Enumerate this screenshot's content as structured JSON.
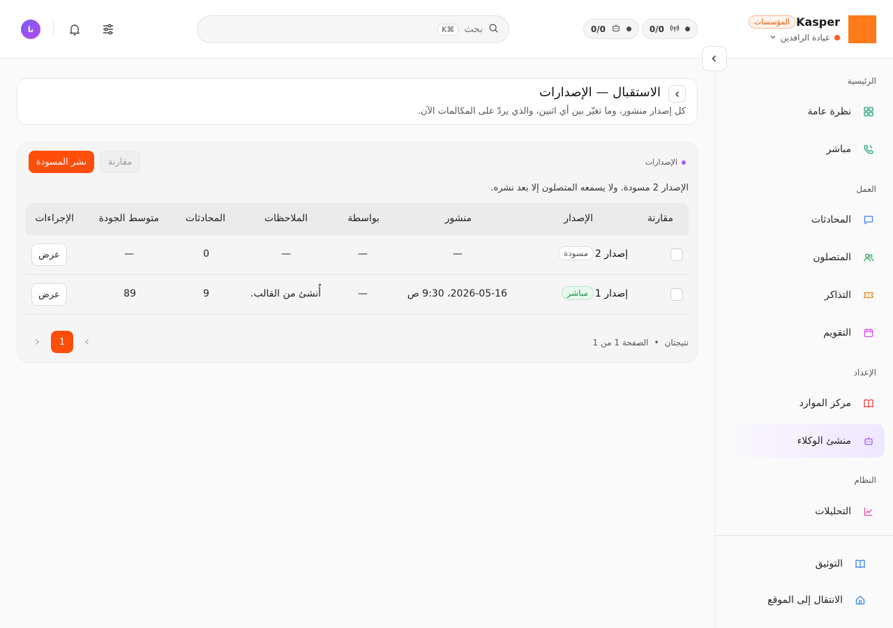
{
  "header": {
    "brand": "Kasper",
    "org_badge": "المؤسسات",
    "clinic": "عيادة الرافدين",
    "counter_calls": "0/0",
    "counter_agents": "0/0",
    "search_placeholder": "بحث",
    "search_shortcut": "⌘K",
    "avatar_initials": "نا"
  },
  "sidebar": {
    "sections": {
      "home": "الرئيسية",
      "work": "العمل",
      "setup": "الإعداد",
      "system": "النظام"
    },
    "items": {
      "overview": "نظرة عامة",
      "live": "مباشر",
      "conversations": "المحادثات",
      "callers": "المتصلون",
      "tickets": "التذاكر",
      "calendar": "التقويم",
      "resources": "مركز الموارد",
      "agent_builder": "منشئ الوكلاء",
      "analytics": "التحليلات",
      "docs": "التوثيق",
      "go_to_site": "الانتقال إلى الموقع"
    },
    "icon_colors": {
      "overview": "#1aa37a",
      "live": "#1aa37a",
      "conversations": "#3b82f6",
      "callers": "#22a35a",
      "tickets": "#f08a24",
      "calendar": "#d946ef",
      "resources": "#ef4444",
      "agent_builder": "#a855f7",
      "analytics": "#ec4899",
      "docs": "#3b82f6",
      "go_to_site": "#3b82f6"
    }
  },
  "page": {
    "title": "الاستقبال — الإصدارات",
    "subtitle": "كل إصدار منشور، وما تغيّر بين أي اثنين، والذي يردّ على المكالمات الآن."
  },
  "panel": {
    "tag": "الإصدارات",
    "publish_label": "نشر المسودة",
    "compare_label": "مقارنة",
    "note": "الإصدار 2 مسودة. ولا يسمعه المتصلون إلا بعد نشره."
  },
  "table": {
    "columns": {
      "compare": "مقارنة",
      "version": "الإصدار",
      "published": "منشور",
      "by": "بواسطة",
      "notes": "الملاحظات",
      "conversations": "المحادثات",
      "avg_quality": "متوسط الجودة",
      "actions": "الإجراءات"
    },
    "rows": [
      {
        "version": "إصدار 2",
        "status": "مسودة",
        "published": "—",
        "by": "—",
        "notes": "—",
        "conversations": "0",
        "avg_quality": "—",
        "action": "عرض"
      },
      {
        "version": "إصدار 1",
        "status": "مباشر",
        "published": "2026-05-16، 9:30 ص",
        "by": "—",
        "notes": "أُنشئ من القالب.",
        "conversations": "9",
        "avg_quality": "89",
        "action": "عرض"
      }
    ]
  },
  "pagination": {
    "results": "نتيجتان",
    "separator": "•",
    "page_info": "الصفحة 1 من 1",
    "current": "1"
  }
}
